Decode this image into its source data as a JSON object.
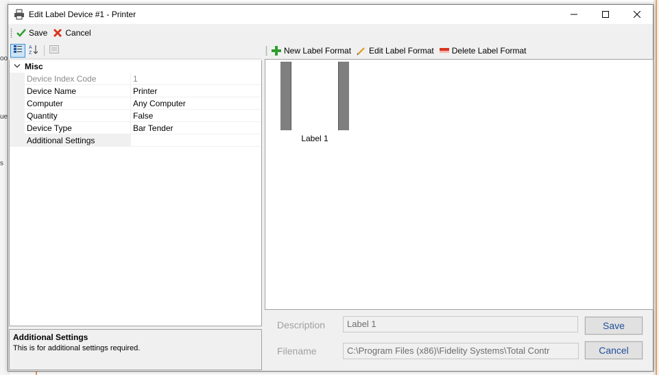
{
  "window": {
    "title": "Edit Label Device #1 - Printer",
    "minimize_glyph": "—",
    "maximize_glyph": "☐",
    "close_glyph": "✕"
  },
  "toolbar": {
    "save_label": "Save",
    "cancel_label": "Cancel"
  },
  "background": {
    "left_fragments": [
      "oo",
      "ue",
      "s"
    ]
  },
  "property_grid": {
    "category": "Misc",
    "rows": [
      {
        "name": "Device Index Code",
        "value": "1",
        "readonly": true
      },
      {
        "name": "Device Name",
        "value": "Printer",
        "readonly": false
      },
      {
        "name": "Computer",
        "value": "Any Computer",
        "readonly": false
      },
      {
        "name": "Quantity",
        "value": "False",
        "readonly": false
      },
      {
        "name": "Device Type",
        "value": "Bar Tender",
        "readonly": false
      },
      {
        "name": "Additional Settings",
        "value": "",
        "readonly": false
      }
    ],
    "help_title": "Additional Settings",
    "help_text": "This is for additional settings required."
  },
  "label_toolbar": {
    "new_label": "New Label Format",
    "edit_label": "Edit Label Format",
    "delete_label": "Delete Label Format"
  },
  "labels": [
    {
      "caption": "Label 1"
    }
  ],
  "form": {
    "description_label": "Description",
    "description_value": "Label 1",
    "filename_label": "Filename",
    "filename_value": "C:\\Program Files (x86)\\Fidelity Systems\\Total Contr",
    "save_label": "Save",
    "cancel_label": "Cancel"
  },
  "colors": {
    "accent_blue": "#1f4e9a",
    "selection": "#cce4f7",
    "add_green": "#2e9e2e",
    "cancel_red": "#d9341e"
  }
}
